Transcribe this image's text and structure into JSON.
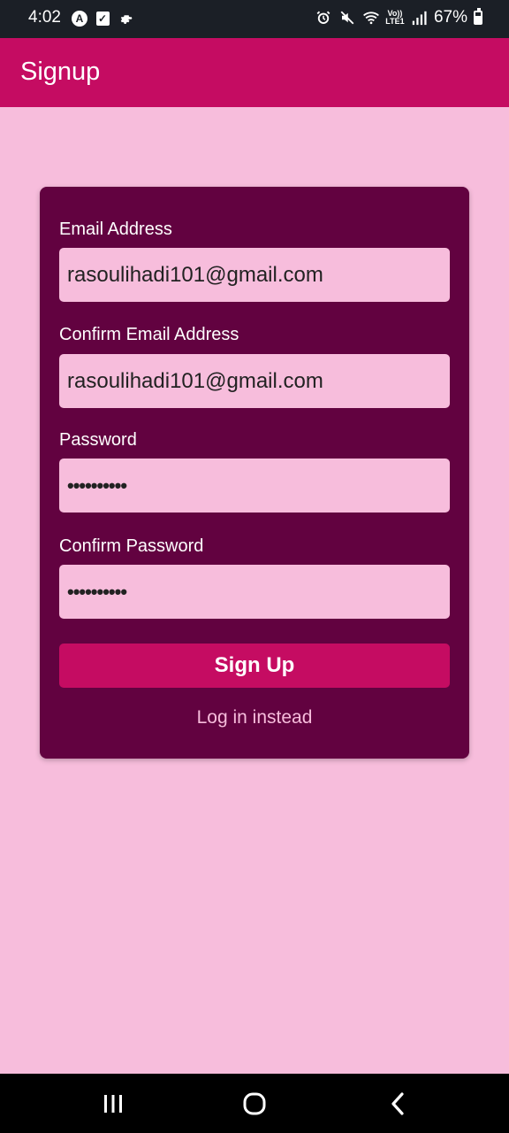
{
  "status_bar": {
    "time": "4:02",
    "left_icons": [
      "autodesk-a-icon",
      "check-box-icon",
      "gear-icon"
    ],
    "right_icons": [
      "alarm-icon",
      "mute-icon",
      "wifi-icon",
      "volte-icon",
      "signal-icon",
      "battery-icon"
    ],
    "volte_top": "Vo))",
    "volte_bottom": "LTE1",
    "battery": "67%"
  },
  "app_bar": {
    "title": "Signup"
  },
  "form": {
    "email_label": "Email Address",
    "email_value": "rasoulihadi101@gmail.com",
    "confirm_email_label": "Confirm Email Address",
    "confirm_email_value": "rasoulihadi101@gmail.com",
    "password_label": "Password",
    "password_value": "••••••••••",
    "confirm_password_label": "Confirm Password",
    "confirm_password_value": "••••••••••",
    "signup_button": "Sign Up",
    "login_link": "Log in instead"
  },
  "nav_bar": {
    "items": [
      "recent-apps-icon",
      "home-icon",
      "back-icon"
    ]
  },
  "colors": {
    "background": "#f7bddc",
    "primary": "#c50c62",
    "card": "#620240",
    "status_bar": "#1b1f26"
  }
}
